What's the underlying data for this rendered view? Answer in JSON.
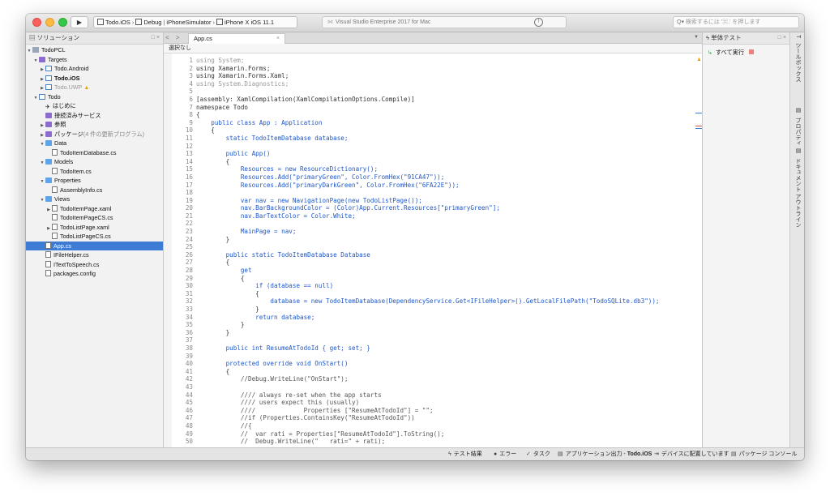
{
  "titlebar": {
    "config_project": "Todo.iOS",
    "config_build": "Debug",
    "config_target": "iPhoneSimulator",
    "config_device": "iPhone X iOS 11.1",
    "status_text": "Visual Studio Enterprise 2017 for Mac",
    "search_placeholder": "検索するには '⌘.' を押します"
  },
  "solution": {
    "title": "ソリューション",
    "controls": "□ ×",
    "items": [
      {
        "label": "TodoPCL",
        "note": "",
        "arrow": "▼",
        "icon": "sol",
        "indent": 0
      },
      {
        "label": "Targets",
        "note": "",
        "arrow": "▼",
        "icon": "folder-p",
        "indent": 1
      },
      {
        "label": "Todo.Android",
        "note": "",
        "arrow": "▶",
        "icon": "proj",
        "indent": 2
      },
      {
        "label": "Todo.iOS",
        "note": "",
        "arrow": "▶",
        "icon": "proj",
        "indent": 2
      },
      {
        "label": "Todo.UWP",
        "note": "",
        "arrow": "▶",
        "icon": "proj",
        "indent": 2
      },
      {
        "label": "Todo",
        "note": "",
        "arrow": "▼",
        "icon": "proj",
        "indent": 1
      },
      {
        "label": "はじめに",
        "note": "",
        "arrow": "",
        "icon": "start",
        "indent": 2
      },
      {
        "label": "接続済みサービス",
        "note": "",
        "arrow": "",
        "icon": "folder-p",
        "indent": 2
      },
      {
        "label": "参照",
        "note": "",
        "arrow": "▶",
        "icon": "folder-p",
        "indent": 2
      },
      {
        "label": "パッケージ",
        "note": "(4 件の更新プログラム)",
        "arrow": "▶",
        "icon": "folder-p",
        "indent": 2
      },
      {
        "label": "Data",
        "note": "",
        "arrow": "▼",
        "icon": "folder",
        "indent": 2
      },
      {
        "label": "TodoItemDatabase.cs",
        "note": "",
        "arrow": "",
        "icon": "file",
        "indent": 3
      },
      {
        "label": "Models",
        "note": "",
        "arrow": "▼",
        "icon": "folder",
        "indent": 2
      },
      {
        "label": "TodoItem.cs",
        "note": "",
        "arrow": "",
        "icon": "file",
        "indent": 3
      },
      {
        "label": "Properties",
        "note": "",
        "arrow": "▼",
        "icon": "folder",
        "indent": 2
      },
      {
        "label": "AssemblyInfo.cs",
        "note": "",
        "arrow": "",
        "icon": "file",
        "indent": 3
      },
      {
        "label": "Views",
        "note": "",
        "arrow": "▼",
        "icon": "folder",
        "indent": 2
      },
      {
        "label": "TodoItemPage.xaml",
        "note": "",
        "arrow": "▶",
        "icon": "file",
        "indent": 3
      },
      {
        "label": "TodoItemPageCS.cs",
        "note": "",
        "arrow": "",
        "icon": "file",
        "indent": 3
      },
      {
        "label": "TodoListPage.xaml",
        "note": "",
        "arrow": "▶",
        "icon": "file",
        "indent": 3
      },
      {
        "label": "TodoListPageCS.cs",
        "note": "",
        "arrow": "",
        "icon": "file",
        "indent": 3
      },
      {
        "label": "App.cs",
        "note": "",
        "arrow": "",
        "icon": "file",
        "indent": 2
      },
      {
        "label": "IFileHelper.cs",
        "note": "",
        "arrow": "",
        "icon": "file",
        "indent": 2
      },
      {
        "label": "ITextToSpeech.cs",
        "note": "",
        "arrow": "",
        "icon": "file",
        "indent": 2
      },
      {
        "label": "packages.config",
        "note": "",
        "arrow": "",
        "icon": "file",
        "indent": 2
      }
    ]
  },
  "editor": {
    "nav_arrows": "< >",
    "tab_label": "App.cs",
    "tab_close": "×",
    "tab_dropdown": "▼",
    "path_label": "選択なし",
    "lines": [
      {
        "n": "1",
        "t": "using System;",
        "c": "dimu"
      },
      {
        "n": "2",
        "t": "using Xamarin.Forms;",
        "c": ""
      },
      {
        "n": "3",
        "t": "using Xamarin.Forms.Xaml;",
        "c": ""
      },
      {
        "n": "4",
        "t": "using System.Diagnostics;",
        "c": "dimu"
      },
      {
        "n": "5",
        "t": "",
        "c": ""
      },
      {
        "n": "6",
        "t": "[assembly: XamlCompilation(XamlCompilationOptions.Compile)]",
        "c": ""
      },
      {
        "n": "7",
        "t": "namespace Todo",
        "c": ""
      },
      {
        "n": "8",
        "t": "{",
        "c": ""
      },
      {
        "n": "9",
        "t": "    public class App : Application",
        "c": "kw"
      },
      {
        "n": "10",
        "t": "    {",
        "c": ""
      },
      {
        "n": "11",
        "t": "        static TodoItemDatabase database;",
        "c": "kw"
      },
      {
        "n": "12",
        "t": "",
        "c": ""
      },
      {
        "n": "13",
        "t": "        public App()",
        "c": "kw"
      },
      {
        "n": "14",
        "t": "        {",
        "c": ""
      },
      {
        "n": "15",
        "t": "            Resources = new ResourceDictionary();",
        "c": "kw"
      },
      {
        "n": "16",
        "t": "            Resources.Add(\"primaryGreen\", Color.FromHex(\"91CA47\"));",
        "c": "kw"
      },
      {
        "n": "17",
        "t": "            Resources.Add(\"primaryDarkGreen\", Color.FromHex(\"6FA22E\"));",
        "c": "kw"
      },
      {
        "n": "18",
        "t": "",
        "c": ""
      },
      {
        "n": "19",
        "t": "            var nav = new NavigationPage(new TodoListPage());",
        "c": "kw"
      },
      {
        "n": "20",
        "t": "            nav.BarBackgroundColor = (Color)App.Current.Resources[\"primaryGreen\"];",
        "c": "kw"
      },
      {
        "n": "21",
        "t": "            nav.BarTextColor = Color.White;",
        "c": "kw"
      },
      {
        "n": "22",
        "t": "",
        "c": ""
      },
      {
        "n": "23",
        "t": "            MainPage = nav;",
        "c": "kw"
      },
      {
        "n": "24",
        "t": "        }",
        "c": ""
      },
      {
        "n": "25",
        "t": "",
        "c": ""
      },
      {
        "n": "26",
        "t": "        public static TodoItemDatabase Database",
        "c": "kw"
      },
      {
        "n": "27",
        "t": "        {",
        "c": ""
      },
      {
        "n": "28",
        "t": "            get",
        "c": "kw"
      },
      {
        "n": "29",
        "t": "            {",
        "c": ""
      },
      {
        "n": "30",
        "t": "                if (database == null)",
        "c": "kw"
      },
      {
        "n": "31",
        "t": "                {",
        "c": ""
      },
      {
        "n": "32",
        "t": "                    database = new TodoItemDatabase(DependencyService.Get<IFileHelper>().GetLocalFilePath(\"TodoSQLite.db3\"));",
        "c": "kw"
      },
      {
        "n": "33",
        "t": "                }",
        "c": ""
      },
      {
        "n": "34",
        "t": "                return database;",
        "c": "kw"
      },
      {
        "n": "35",
        "t": "            }",
        "c": ""
      },
      {
        "n": "36",
        "t": "        }",
        "c": ""
      },
      {
        "n": "37",
        "t": "",
        "c": ""
      },
      {
        "n": "38",
        "t": "        public int ResumeAtTodoId { get; set; }",
        "c": "kw"
      },
      {
        "n": "39",
        "t": "",
        "c": ""
      },
      {
        "n": "40",
        "t": "        protected override void OnStart()",
        "c": "kw"
      },
      {
        "n": "41",
        "t": "        {",
        "c": ""
      },
      {
        "n": "42",
        "t": "            //Debug.WriteLine(\"OnStart\");",
        "c": "cmt"
      },
      {
        "n": "43",
        "t": "",
        "c": ""
      },
      {
        "n": "44",
        "t": "            //// always re-set when the app starts",
        "c": "cmt"
      },
      {
        "n": "45",
        "t": "            //// users expect this (usually)",
        "c": "cmt"
      },
      {
        "n": "46",
        "t": "            ////             Properties [\"ResumeAtTodoId\"] = \"\";",
        "c": "cmt"
      },
      {
        "n": "47",
        "t": "            //if (Properties.ContainsKey(\"ResumeAtTodoId\"))",
        "c": "cmt"
      },
      {
        "n": "48",
        "t": "            //{",
        "c": "cmt"
      },
      {
        "n": "49",
        "t": "            //  var rati = Properties[\"ResumeAtTodoId\"].ToString();",
        "c": "cmt"
      },
      {
        "n": "50",
        "t": "            //  Debug.WriteLine(\"   rati=\" + rati);",
        "c": "cmt"
      }
    ]
  },
  "testpad": {
    "title": "単体テスト",
    "controls": "□ ×",
    "run_all": "すべて実行"
  },
  "right_dock": {
    "tabs": [
      {
        "icon": "T",
        "label": "ツールボックス"
      },
      {
        "icon": "▤",
        "label": "プロパティ"
      },
      {
        "icon": "▤",
        "label": "ドキュメント アウトライン"
      }
    ]
  },
  "statusbar": {
    "test_results": "テスト結果",
    "errors": "エラー",
    "tasks": "タスク",
    "app_output_prefix": "アプリケーション出力 - ",
    "app_output_project": "Todo.iOS",
    "deploying": "デバイスに配置しています",
    "package_console": "パッケージ コンソール"
  }
}
